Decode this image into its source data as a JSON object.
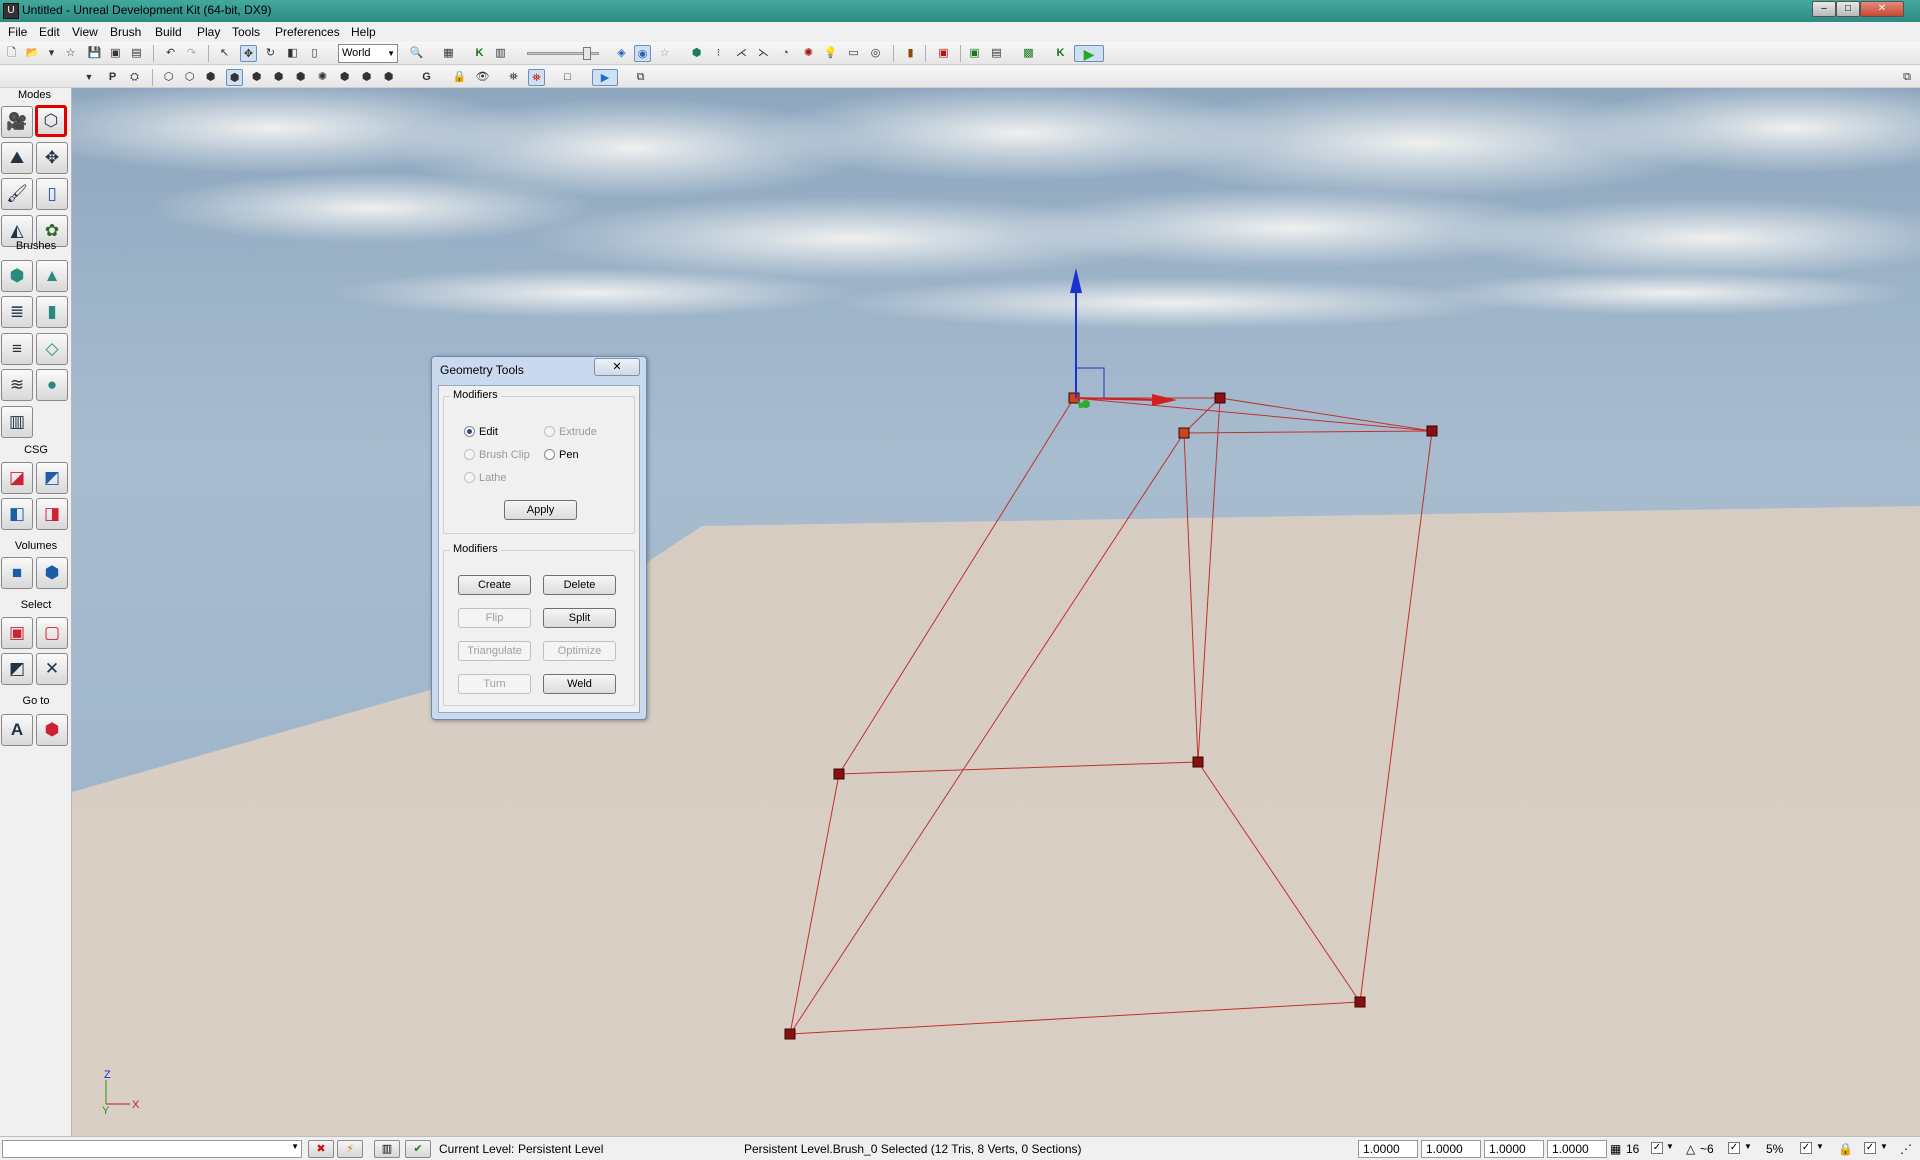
{
  "window": {
    "title": "Untitled - Unreal Development Kit (64-bit, DX9)"
  },
  "menu": [
    "File",
    "Edit",
    "View",
    "Brush",
    "Build",
    "Play",
    "Tools",
    "Preferences",
    "Help"
  ],
  "toolbar": {
    "coordinate_system": "World",
    "speed_slider_fraction": 0.88
  },
  "modes_panel": {
    "header": "Modes",
    "sections": {
      "brushes": "Brushes",
      "csg": "CSG",
      "volumes": "Volumes",
      "select": "Select",
      "goto": "Go to"
    }
  },
  "geometry_tools": {
    "title": "Geometry Tools",
    "close_label": "✕",
    "modes_group_label": "Modifiers",
    "radios": {
      "edit": "Edit",
      "extrude": "Extrude",
      "brush_clip": "Brush Clip",
      "pen": "Pen",
      "lathe": "Lathe"
    },
    "selected_mode": "Edit",
    "apply_label": "Apply",
    "modifiers_group_label": "Modifiers",
    "buttons": {
      "create": "Create",
      "delete": "Delete",
      "flip": "Flip",
      "split": "Split",
      "triangulate": "Triangulate",
      "optimize": "Optimize",
      "turn": "Turn",
      "weld": "Weld"
    }
  },
  "viewport": {
    "axis_labels": {
      "z": "Z",
      "y": "Y",
      "x": "X"
    },
    "colors": {
      "sky": "#9fb3c8",
      "ground": "#d6cbc0",
      "wire": "#c03030",
      "vertex": "#8a0f0f"
    }
  },
  "statusbar": {
    "current_level_label": "Current Level:",
    "current_level": "Persistent Level",
    "selection_info": "Persistent Level.Brush_0 Selected (12 Tris, 8 Verts, 0 Sections)",
    "scale_x": "1.0000",
    "scale_y": "1.0000",
    "scale_z": "1.0000",
    "scale_uniform": "1.0000",
    "grid_size": "16",
    "rotation_snap": "~6",
    "scale_snap": "5%"
  }
}
